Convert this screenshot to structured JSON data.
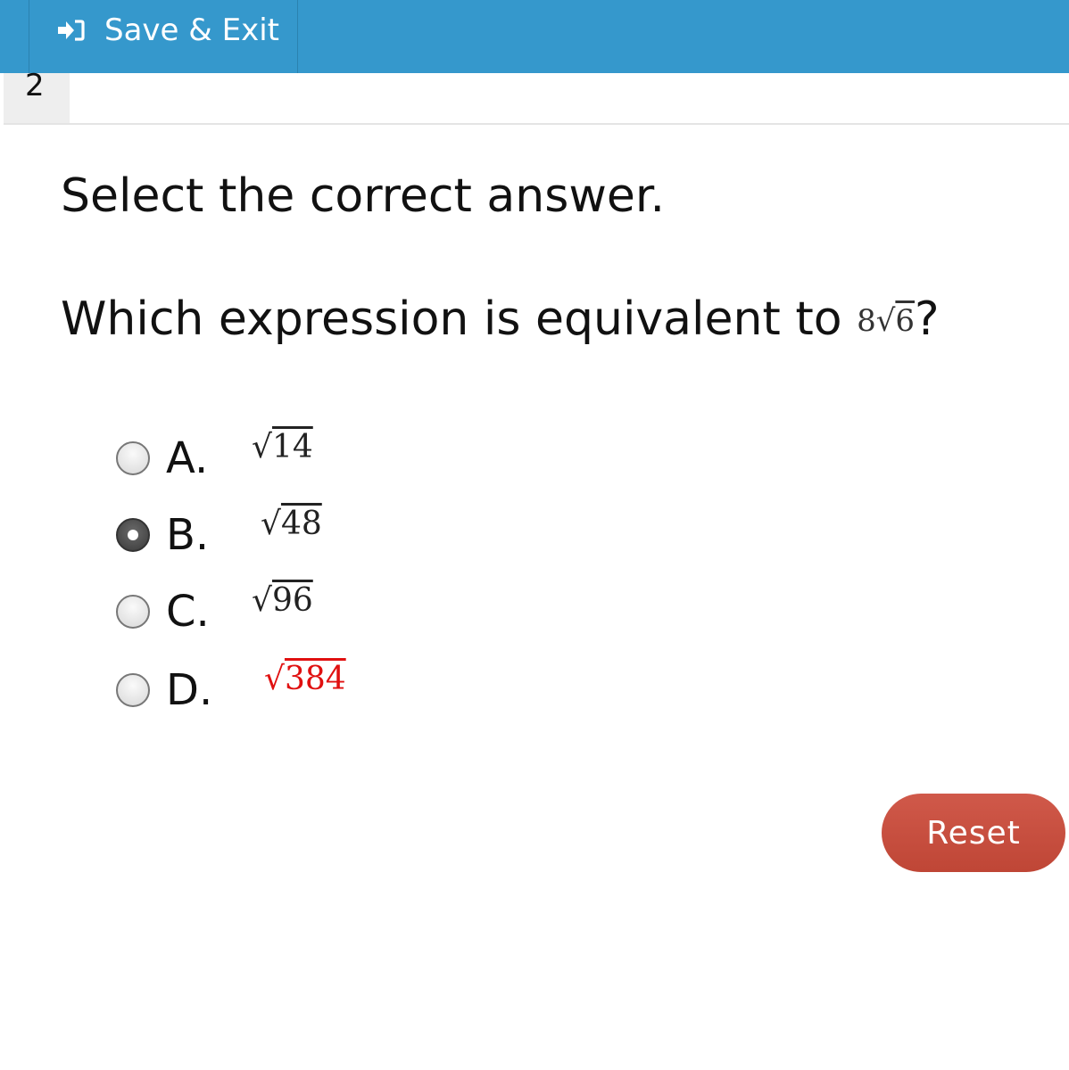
{
  "header": {
    "save_exit_label": "Save & Exit",
    "save_exit_icon": "sign-in-arrow-icon",
    "background_color": "#3598cc"
  },
  "question_number": "2",
  "instruction": "Select the correct answer.",
  "question": {
    "text": "Which expression is equivalent to ",
    "expression_coefficient": "8",
    "expression_radical_symbol": "√",
    "expression_radicand": "6",
    "suffix": "?"
  },
  "options": [
    {
      "letter": "A.",
      "radical_symbol": "√",
      "radicand": "14",
      "selected": false,
      "color": "#222222"
    },
    {
      "letter": "B.",
      "radical_symbol": "√",
      "radicand": "48",
      "selected": true,
      "color": "#222222"
    },
    {
      "letter": "C.",
      "radical_symbol": "√",
      "radicand": "96",
      "selected": false,
      "color": "#222222"
    },
    {
      "letter": "D.",
      "radical_symbol": "√",
      "radicand": "384",
      "selected": false,
      "color": "#e01010"
    }
  ],
  "reset_label": "Reset",
  "reset_color": "#c74d3c"
}
